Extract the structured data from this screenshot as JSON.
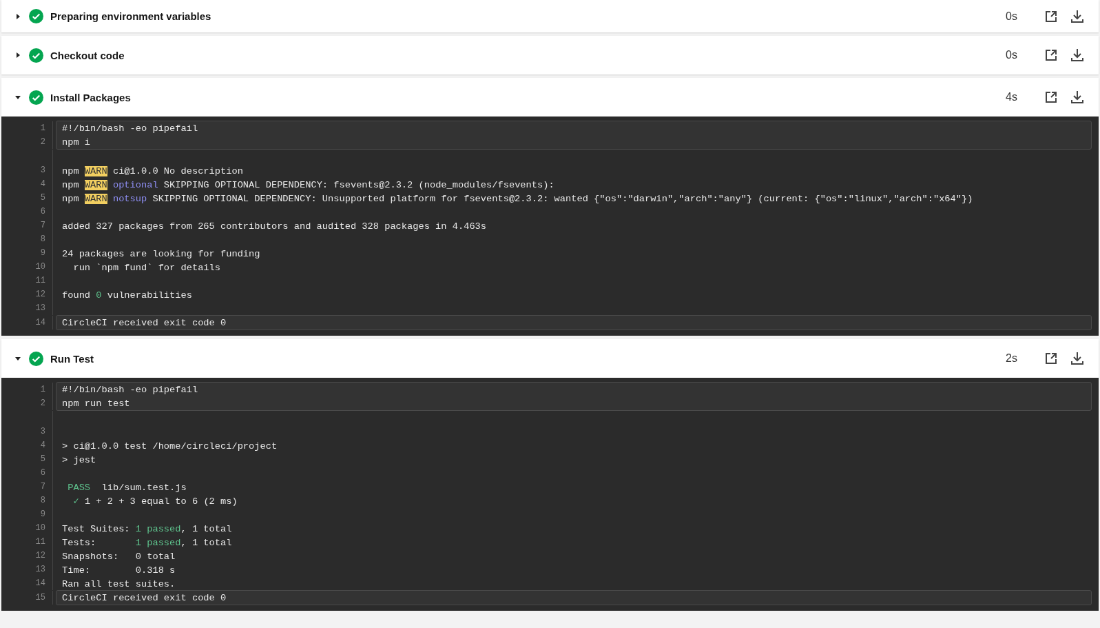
{
  "steps": [
    {
      "title": "Preparing environment variables",
      "succeeded": true,
      "duration": "0s",
      "expanded": false
    },
    {
      "title": "Checkout code",
      "succeeded": true,
      "duration": "0s",
      "expanded": false
    },
    {
      "title": "Install Packages",
      "succeeded": true,
      "duration": "4s",
      "expanded": true,
      "log": {
        "command": [
          {
            "num": "1",
            "segments": [
              {
                "kind": "plain",
                "text": "#!/bin/bash -eo pipefail"
              }
            ]
          },
          {
            "num": "2",
            "segments": [
              {
                "kind": "plain",
                "text": "npm i"
              }
            ]
          }
        ],
        "output": [
          {
            "num": "3",
            "segments": [
              {
                "kind": "plain",
                "text": "npm "
              },
              {
                "kind": "warn",
                "text": "WARN"
              },
              {
                "kind": "plain",
                "text": " ci@1.0.0 No description"
              }
            ]
          },
          {
            "num": "4",
            "segments": [
              {
                "kind": "plain",
                "text": "npm "
              },
              {
                "kind": "warn",
                "text": "WARN"
              },
              {
                "kind": "purple",
                "text": " optional"
              },
              {
                "kind": "plain",
                "text": " SKIPPING OPTIONAL DEPENDENCY: fsevents@2.3.2 (node_modules/fsevents):"
              }
            ]
          },
          {
            "num": "5",
            "segments": [
              {
                "kind": "plain",
                "text": "npm "
              },
              {
                "kind": "warn",
                "text": "WARN"
              },
              {
                "kind": "purple",
                "text": " notsup"
              },
              {
                "kind": "plain",
                "text": " SKIPPING OPTIONAL DEPENDENCY: Unsupported platform for fsevents@2.3.2: wanted {\"os\":\"darwin\",\"arch\":\"any\"} (current: {\"os\":\"linux\",\"arch\":\"x64\"})"
              }
            ]
          },
          {
            "num": "6"
          },
          {
            "num": "7",
            "segments": [
              {
                "kind": "plain",
                "text": "added 327 packages from 265 contributors and audited 328 packages in 4.463s"
              }
            ]
          },
          {
            "num": "8"
          },
          {
            "num": "9",
            "segments": [
              {
                "kind": "plain",
                "text": "24 packages are looking for funding"
              }
            ]
          },
          {
            "num": "10",
            "segments": [
              {
                "kind": "plain",
                "text": "  run `npm fund` for details"
              }
            ]
          },
          {
            "num": "11"
          },
          {
            "num": "12",
            "segments": [
              {
                "kind": "plain",
                "text": "found "
              },
              {
                "kind": "green",
                "text": "0"
              },
              {
                "kind": "plain",
                "text": " vulnerabilities"
              }
            ]
          },
          {
            "num": "13"
          }
        ],
        "exit": {
          "num": "14",
          "segments": [
            {
              "kind": "plain",
              "text": "CircleCI received exit code 0"
            }
          ]
        }
      }
    },
    {
      "title": "Run Test",
      "succeeded": true,
      "duration": "2s",
      "expanded": true,
      "log": {
        "command": [
          {
            "num": "1",
            "segments": [
              {
                "kind": "plain",
                "text": "#!/bin/bash -eo pipefail"
              }
            ]
          },
          {
            "num": "2",
            "segments": [
              {
                "kind": "plain",
                "text": "npm run test"
              }
            ]
          }
        ],
        "output": [
          {
            "num": "3"
          },
          {
            "num": "4",
            "segments": [
              {
                "kind": "plain",
                "text": "> ci@1.0.0 test /home/circleci/project"
              }
            ]
          },
          {
            "num": "5",
            "segments": [
              {
                "kind": "plain",
                "text": "> jest"
              }
            ]
          },
          {
            "num": "6"
          },
          {
            "num": "7",
            "segments": [
              {
                "kind": "green",
                "text": " PASS"
              },
              {
                "kind": "plain",
                "text": "  lib/sum.test.js"
              }
            ]
          },
          {
            "num": "8",
            "segments": [
              {
                "kind": "green",
                "text": "  ✓"
              },
              {
                "kind": "plain",
                "text": " 1 + 2 + 3 equal to 6 (2 ms)"
              }
            ]
          },
          {
            "num": "9"
          },
          {
            "num": "10",
            "segments": [
              {
                "kind": "plain",
                "text": "Test Suites: "
              },
              {
                "kind": "green",
                "text": "1 passed"
              },
              {
                "kind": "plain",
                "text": ", 1 total"
              }
            ]
          },
          {
            "num": "11",
            "segments": [
              {
                "kind": "plain",
                "text": "Tests:       "
              },
              {
                "kind": "green",
                "text": "1 passed"
              },
              {
                "kind": "plain",
                "text": ", 1 total"
              }
            ]
          },
          {
            "num": "12",
            "segments": [
              {
                "kind": "plain",
                "text": "Snapshots:   0 total"
              }
            ]
          },
          {
            "num": "13",
            "segments": [
              {
                "kind": "plain",
                "text": "Time:        0.318 s"
              }
            ]
          },
          {
            "num": "14",
            "segments": [
              {
                "kind": "plain",
                "text": "Ran all test suites."
              }
            ]
          }
        ],
        "exit": {
          "num": "15",
          "segments": [
            {
              "kind": "plain",
              "text": "CircleCI received exit code 0"
            }
          ]
        }
      }
    }
  ]
}
